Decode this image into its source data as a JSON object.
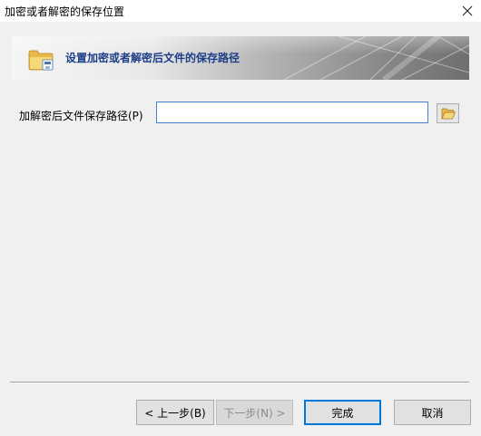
{
  "window": {
    "title": "加密或者解密的保存位置",
    "close_glyph": "✕"
  },
  "banner": {
    "title": "设置加密或者解密后文件的保存路径",
    "icon": "folder-icon"
  },
  "form": {
    "path_label": "加解密后文件保存路径(P)",
    "path_value": "",
    "browse_icon": "open-folder-icon"
  },
  "buttons": {
    "prev": "< 上一步(B)",
    "next": "下一步(N) >",
    "finish": "完成",
    "cancel": "取消"
  },
  "colors": {
    "banner_title": "#1d3f88",
    "input_border": "#3f83d6",
    "default_button_border": "#0078d7"
  }
}
